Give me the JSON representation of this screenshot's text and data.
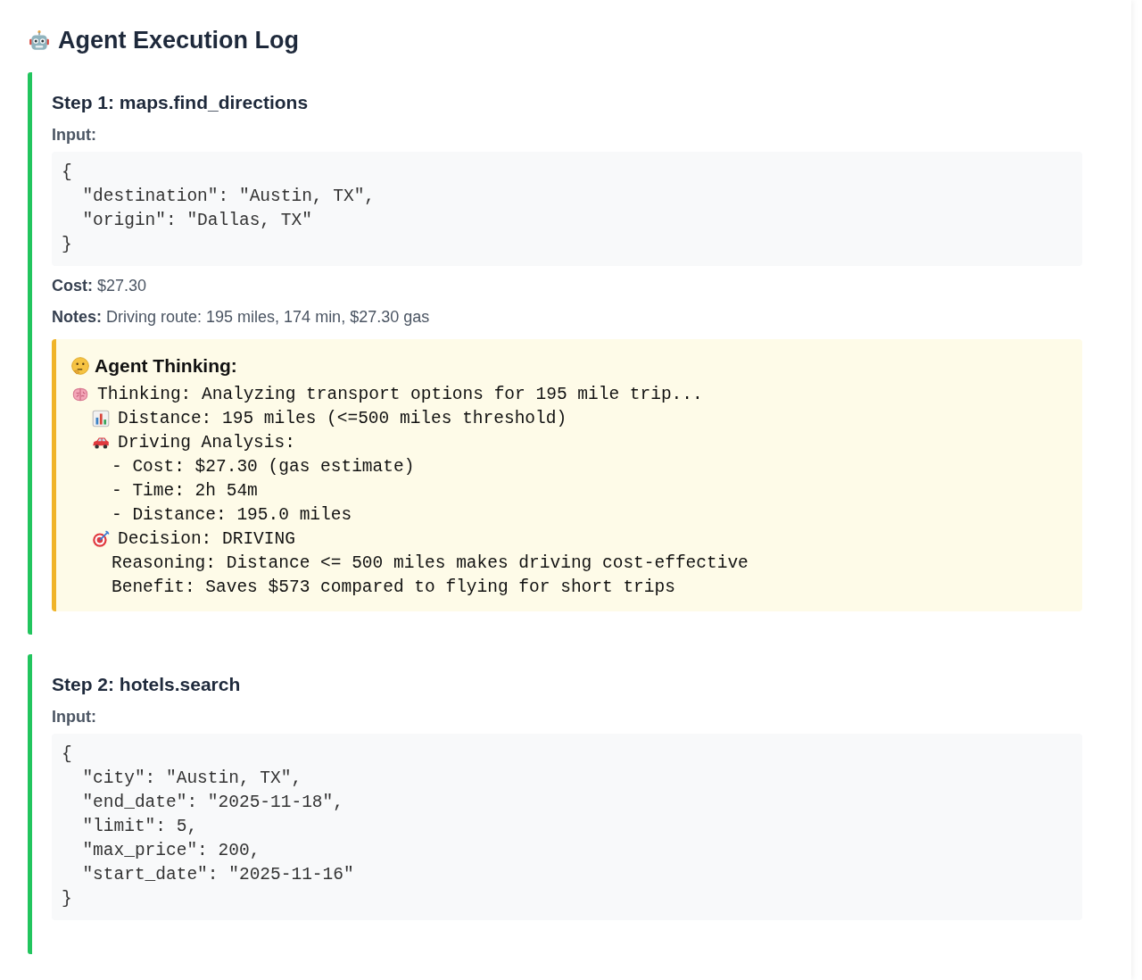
{
  "title": "Agent Execution Log",
  "steps": [
    {
      "title": "Step 1: maps.find_directions",
      "input_label": "Input:",
      "input": "{\n  \"destination\": \"Austin, TX\",\n  \"origin\": \"Dallas, TX\"\n}",
      "fields": [
        {
          "label": "Cost:",
          "value": "$27.30"
        },
        {
          "label": "Notes:",
          "value": "Driving route: 195 miles, 174 min, $27.30 gas"
        }
      ],
      "thinking": {
        "title": "Agent Thinking:",
        "lines": [
          {
            "kind": "brain",
            "text": "Thinking: Analyzing transport options for 195 mile trip...",
            "children": [
              {
                "kind": "chart",
                "text": "Distance: 195 miles (<=500 miles threshold)"
              },
              {
                "kind": "car",
                "text": "Driving Analysis:",
                "children": [
                  {
                    "text": "- Cost: $27.30 (gas estimate)"
                  },
                  {
                    "text": "- Time: 2h 54m"
                  },
                  {
                    "text": "- Distance: 195.0 miles"
                  }
                ]
              },
              {
                "kind": "target",
                "text": "Decision: DRIVING",
                "children": [
                  {
                    "text": "Reasoning: Distance <= 500 miles makes driving cost-effective"
                  },
                  {
                    "text": "Benefit: Saves $573 compared to flying for short trips"
                  }
                ]
              }
            ]
          }
        ]
      }
    },
    {
      "title": "Step 2: hotels.search",
      "input_label": "Input:",
      "input": "{\n  \"city\": \"Austin, TX\",\n  \"end_date\": \"2025-11-18\",\n  \"limit\": 5,\n  \"max_price\": 200,\n  \"start_date\": \"2025-11-16\"\n}"
    }
  ]
}
